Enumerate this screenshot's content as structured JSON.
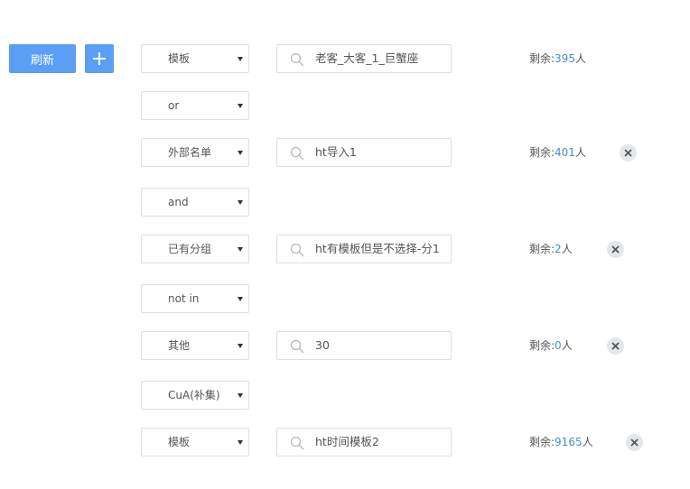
{
  "toolbar": {
    "refresh_label": "刷新",
    "add_icon": "plus-icon"
  },
  "remain_prefix": "剩余:",
  "remain_suffix": "人",
  "rows": [
    {
      "type": "condition",
      "select": "模板",
      "search": "老客_大客_1_巨蟹座",
      "remain": "395",
      "removable": false
    },
    {
      "type": "operator",
      "select": "or"
    },
    {
      "type": "condition",
      "select": "外部名单",
      "search": "ht导入1",
      "remain": "401",
      "removable": true
    },
    {
      "type": "operator",
      "select": "and"
    },
    {
      "type": "condition",
      "select": "已有分组",
      "search": "ht有模板但是不选择-分1",
      "remain": "2",
      "removable": true
    },
    {
      "type": "operator",
      "select": "not in"
    },
    {
      "type": "condition",
      "select": "其他",
      "search": "30",
      "remain": "0",
      "removable": true
    },
    {
      "type": "operator",
      "select": "CuA(补集)"
    },
    {
      "type": "condition",
      "select": "模板",
      "search": "ht时间模板2",
      "remain": "9165",
      "removable": true
    }
  ],
  "colors": {
    "primary": "#5b9ef5",
    "number": "#4b8cd6",
    "border": "#dcdfe6"
  }
}
